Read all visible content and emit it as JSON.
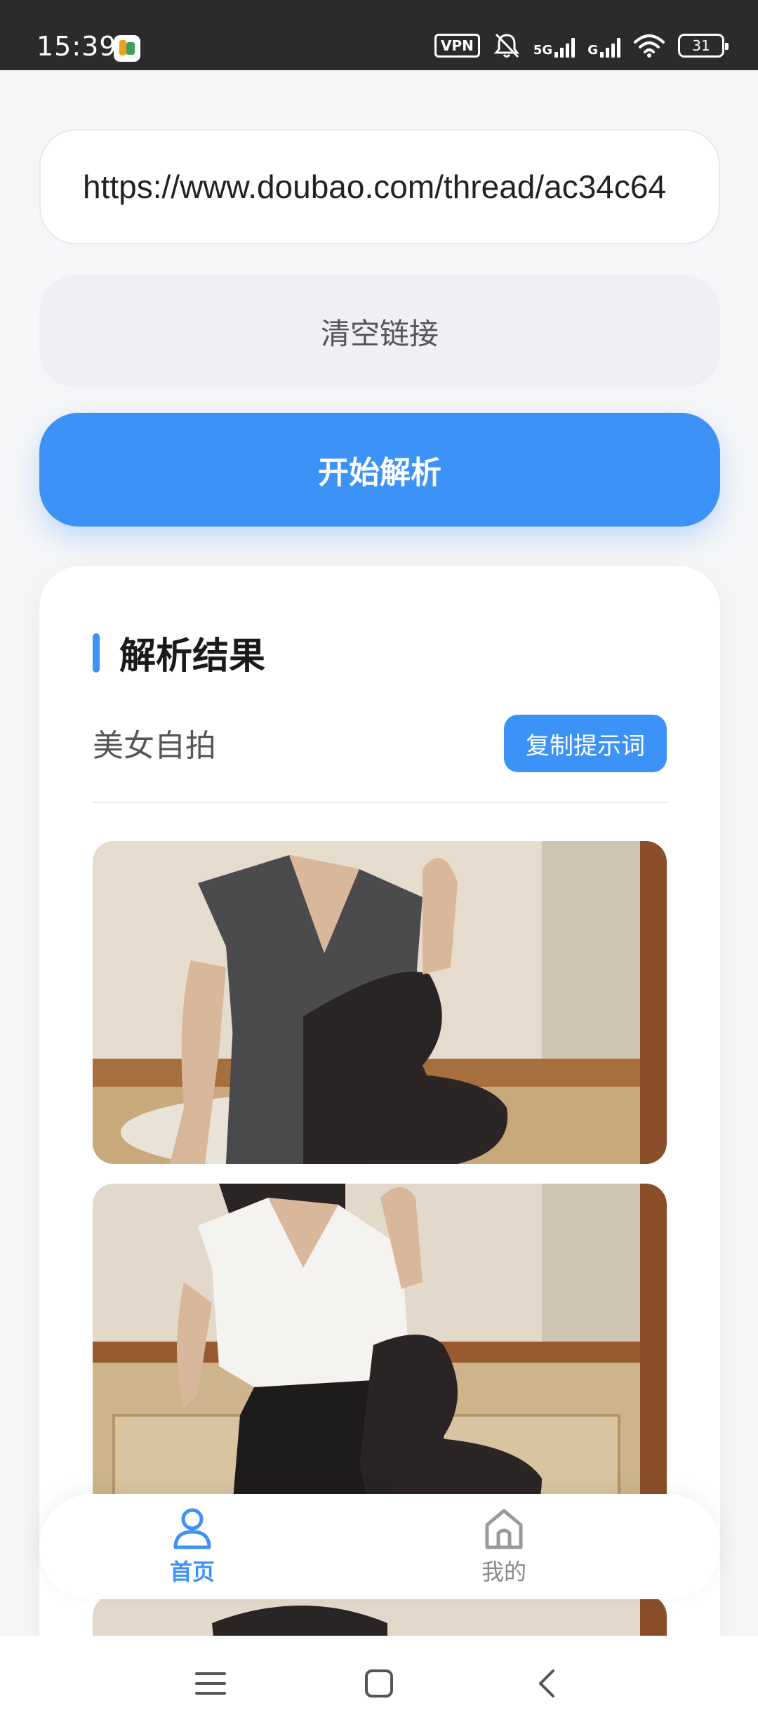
{
  "status_bar": {
    "time": "15:39",
    "vpn": "VPN",
    "sim1": "5G",
    "sim2": "G",
    "battery": "31"
  },
  "url_input": {
    "value": "https://www.doubao.com/thread/ac34c64"
  },
  "clear_button": {
    "label": "清空链接"
  },
  "parse_button": {
    "label": "开始解析"
  },
  "result": {
    "title": "解析结果",
    "prompt": "美女自拍",
    "copy_button": "复制提示词"
  },
  "bottom_nav": {
    "items": [
      {
        "label": "首页",
        "icon": "user-icon",
        "active": true
      },
      {
        "label": "我的",
        "icon": "home-icon",
        "active": false
      }
    ]
  },
  "system_nav": {
    "icons": [
      "menu-icon",
      "home-square-icon",
      "back-icon"
    ]
  },
  "colors": {
    "accent": "#3d92f7",
    "background": "#f5f6f8"
  }
}
